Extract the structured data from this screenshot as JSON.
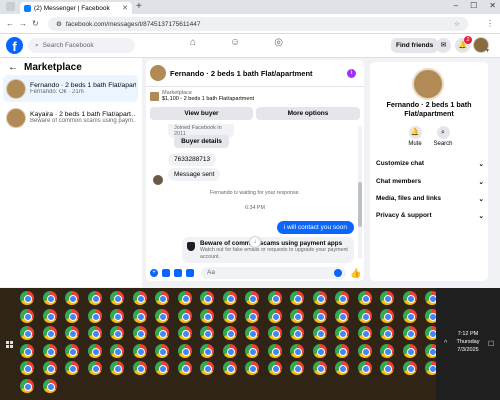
{
  "browser": {
    "tab_title": "(2) Messenger | Facebook",
    "url": "facebook.com/messages/t/8745137175611447"
  },
  "header": {
    "search_placeholder": "Search Facebook",
    "find_friends": "Find friends",
    "notification_count": "2"
  },
  "sidebar": {
    "title": "Marketplace",
    "conversations": [
      {
        "name": "Fernando · 2 beds 1 bath Flat/apart…",
        "subtitle": "Fernando: Ok · 21m"
      },
      {
        "name": "Kayaira · 2 beds 1 bath Flat/apart…",
        "subtitle": "Beware of common scams using paym… · 38m"
      }
    ]
  },
  "chat": {
    "title": "Fernando · 2 beds 1 bath Flat/apartment",
    "listing_source": "Marketplace",
    "listing_detail": "$1,100 - 2 beds 1 bath Flat/apartment",
    "view_buyer": "View buyer",
    "more_options": "More options",
    "joined_text": "Joined Facebook in 2011",
    "buyer_details": "Buyer details",
    "phone_msg": "7633288713",
    "message_sent": "Message sent",
    "waiting_text": "Fernando is waiting for your response.",
    "time": "6:34 PM",
    "outgoing": "i will contact you soon",
    "warning_title": "Beware of common scams using payment apps",
    "warning_body": "Watch out for fake emails or requests to upgrade your payment account.",
    "composer_placeholder": "Aa"
  },
  "details": {
    "name": "Fernando · 2 beds 1 bath Flat/apartment",
    "actions": [
      "Mute",
      "Search"
    ],
    "sections": [
      "Customize chat",
      "Chat members",
      "Media, files and links",
      "Privacy & support"
    ]
  },
  "taskbar": {
    "time": "7:12 PM",
    "day": "Thursday",
    "date": "7/3/2025"
  },
  "colors": {
    "accent": "#0866ff",
    "bg": "#f0f2f5"
  }
}
